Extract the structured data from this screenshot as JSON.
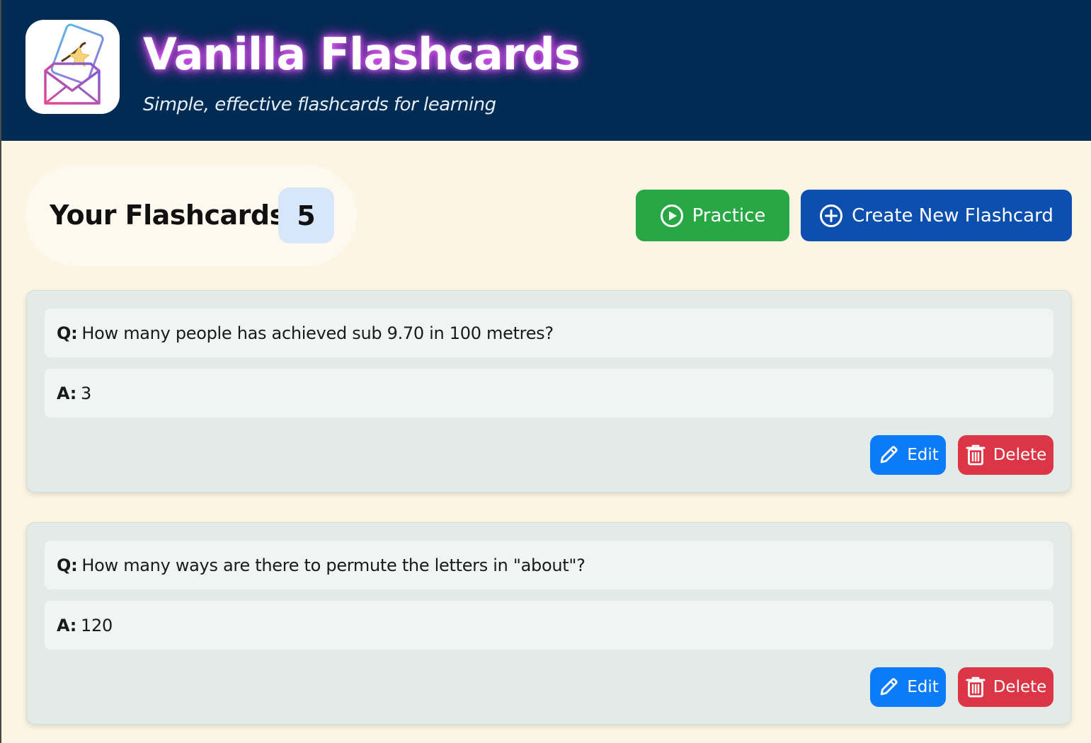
{
  "header": {
    "title": "Vanilla Flashcards",
    "subtitle": "Simple, effective flashcards for learning"
  },
  "toolbar": {
    "count_label": "Your Flashcards:",
    "count": "5",
    "practice_label": "Practice",
    "create_label": "Create New Flashcard"
  },
  "cards": [
    {
      "q_prefix": "Q:",
      "question": "How many people has achieved sub 9.70 in 100 metres?",
      "a_prefix": "A:",
      "answer": "3",
      "edit_label": "Edit",
      "delete_label": "Delete"
    },
    {
      "q_prefix": "Q:",
      "question": "How many ways are there to permute the letters in \"about\"?",
      "a_prefix": "A:",
      "answer": "120",
      "edit_label": "Edit",
      "delete_label": "Delete"
    }
  ],
  "colors": {
    "header_bg": "#002b52",
    "page_bg": "#fdf5e3",
    "practice": "#28a745",
    "create": "#0d4faf",
    "edit": "#0b7bfa",
    "delete": "#dc3545"
  },
  "icons": {
    "logo": "flashcard-envelope-vanilla-icon",
    "practice": "play-circle-icon",
    "create": "plus-circle-icon",
    "edit": "pencil-icon",
    "delete": "trash-icon"
  }
}
